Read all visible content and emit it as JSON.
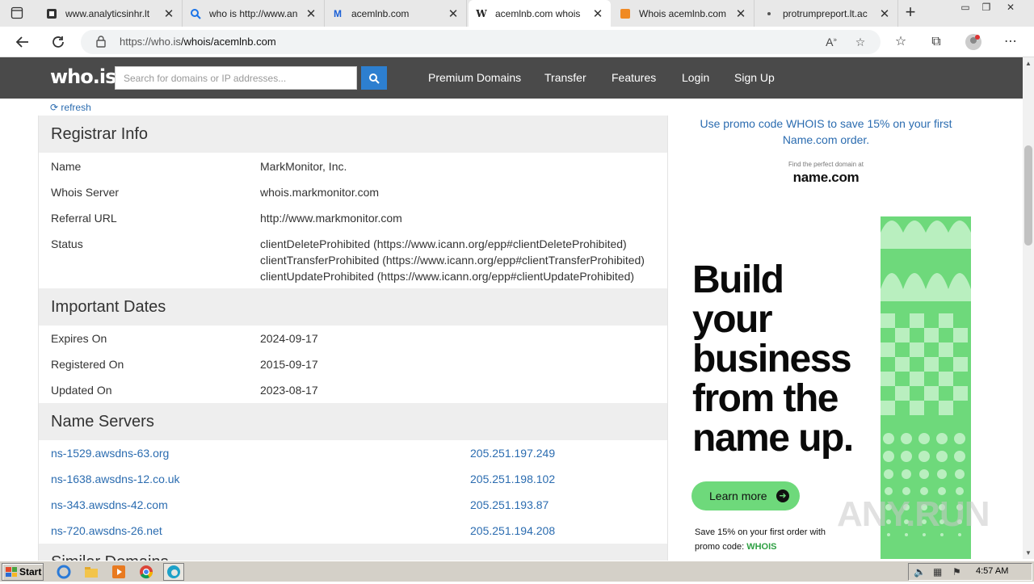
{
  "browser": {
    "tabs": [
      {
        "title": "www.analyticsinhr.lt",
        "favicon": "page-icon"
      },
      {
        "title": "who is http://www.an",
        "favicon": "search-icon"
      },
      {
        "title": "acemlnb.com",
        "favicon": "malwarebytes-icon"
      },
      {
        "title": "acemlnb.com whois",
        "favicon": "whois-icon",
        "active": true
      },
      {
        "title": "Whois acemlnb.com",
        "favicon": "whois-orange-icon"
      },
      {
        "title": "protrumpreport.lt.ac",
        "favicon": "page-icon"
      }
    ],
    "url_host": "https://who.is",
    "url_path": "/whois/acemlnb.com"
  },
  "header": {
    "logo": "who.is",
    "search_placeholder": "Search for domains or IP addresses...",
    "nav": [
      "Premium Domains",
      "Transfer",
      "Features",
      "Login",
      "Sign Up"
    ]
  },
  "main": {
    "refresh_label": "refresh",
    "registrar": {
      "title": "Registrar Info",
      "rows": [
        {
          "label": "Name",
          "value": "MarkMonitor, Inc."
        },
        {
          "label": "Whois Server",
          "value": "whois.markmonitor.com"
        },
        {
          "label": "Referral URL",
          "value": "http://www.markmonitor.com"
        },
        {
          "label": "Status",
          "value": "clientDeleteProhibited (https://www.icann.org/epp#clientDeleteProhibited)"
        }
      ],
      "status_extra": [
        "clientTransferProhibited (https://www.icann.org/epp#clientTransferProhibited)",
        "clientUpdateProhibited (https://www.icann.org/epp#clientUpdateProhibited)"
      ]
    },
    "dates": {
      "title": "Important Dates",
      "rows": [
        {
          "label": "Expires On",
          "value": "2024-09-17"
        },
        {
          "label": "Registered On",
          "value": "2015-09-17"
        },
        {
          "label": "Updated On",
          "value": "2023-08-17"
        }
      ]
    },
    "nameservers": {
      "title": "Name Servers",
      "rows": [
        {
          "host": "ns-1529.awsdns-63.org",
          "ip": "205.251.197.249"
        },
        {
          "host": "ns-1638.awsdns-12.co.uk",
          "ip": "205.251.198.102"
        },
        {
          "host": "ns-343.awsdns-42.com",
          "ip": "205.251.193.87"
        },
        {
          "host": "ns-720.awsdns-26.net",
          "ip": "205.251.194.208"
        }
      ]
    },
    "next_section_title": "Similar Domains"
  },
  "sidebar": {
    "promo_line1": "Use promo code WHOIS to save 15% on your first",
    "promo_line2": "Name.com order.",
    "ad_tagline": "Find the perfect domain at",
    "ad_brand": "name.com",
    "ad_headline": "Build\nyour\nbusiness\nfrom the\nname up.",
    "ad_cta": "Learn more",
    "ad_foot_line1": "Save 15% on your first order with",
    "ad_foot_prefix": "promo code: ",
    "ad_foot_code": "WHOIS",
    "accent": "#6ed97b"
  },
  "watermark": "ANY.RUN",
  "taskbar": {
    "start_label": "Start",
    "clock": "4:57 AM"
  }
}
